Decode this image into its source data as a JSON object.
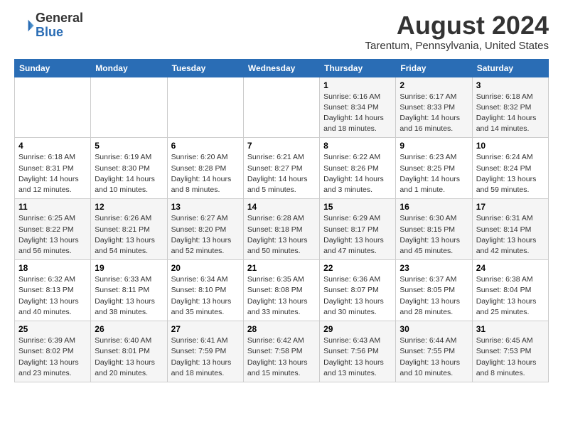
{
  "logo": {
    "general": "General",
    "blue": "Blue"
  },
  "title": "August 2024",
  "location": "Tarentum, Pennsylvania, United States",
  "days_of_week": [
    "Sunday",
    "Monday",
    "Tuesday",
    "Wednesday",
    "Thursday",
    "Friday",
    "Saturday"
  ],
  "weeks": [
    [
      {
        "day": "",
        "info": ""
      },
      {
        "day": "",
        "info": ""
      },
      {
        "day": "",
        "info": ""
      },
      {
        "day": "",
        "info": ""
      },
      {
        "day": "1",
        "info": "Sunrise: 6:16 AM\nSunset: 8:34 PM\nDaylight: 14 hours\nand 18 minutes."
      },
      {
        "day": "2",
        "info": "Sunrise: 6:17 AM\nSunset: 8:33 PM\nDaylight: 14 hours\nand 16 minutes."
      },
      {
        "day": "3",
        "info": "Sunrise: 6:18 AM\nSunset: 8:32 PM\nDaylight: 14 hours\nand 14 minutes."
      }
    ],
    [
      {
        "day": "4",
        "info": "Sunrise: 6:18 AM\nSunset: 8:31 PM\nDaylight: 14 hours\nand 12 minutes."
      },
      {
        "day": "5",
        "info": "Sunrise: 6:19 AM\nSunset: 8:30 PM\nDaylight: 14 hours\nand 10 minutes."
      },
      {
        "day": "6",
        "info": "Sunrise: 6:20 AM\nSunset: 8:28 PM\nDaylight: 14 hours\nand 8 minutes."
      },
      {
        "day": "7",
        "info": "Sunrise: 6:21 AM\nSunset: 8:27 PM\nDaylight: 14 hours\nand 5 minutes."
      },
      {
        "day": "8",
        "info": "Sunrise: 6:22 AM\nSunset: 8:26 PM\nDaylight: 14 hours\nand 3 minutes."
      },
      {
        "day": "9",
        "info": "Sunrise: 6:23 AM\nSunset: 8:25 PM\nDaylight: 14 hours\nand 1 minute."
      },
      {
        "day": "10",
        "info": "Sunrise: 6:24 AM\nSunset: 8:24 PM\nDaylight: 13 hours\nand 59 minutes."
      }
    ],
    [
      {
        "day": "11",
        "info": "Sunrise: 6:25 AM\nSunset: 8:22 PM\nDaylight: 13 hours\nand 56 minutes."
      },
      {
        "day": "12",
        "info": "Sunrise: 6:26 AM\nSunset: 8:21 PM\nDaylight: 13 hours\nand 54 minutes."
      },
      {
        "day": "13",
        "info": "Sunrise: 6:27 AM\nSunset: 8:20 PM\nDaylight: 13 hours\nand 52 minutes."
      },
      {
        "day": "14",
        "info": "Sunrise: 6:28 AM\nSunset: 8:18 PM\nDaylight: 13 hours\nand 50 minutes."
      },
      {
        "day": "15",
        "info": "Sunrise: 6:29 AM\nSunset: 8:17 PM\nDaylight: 13 hours\nand 47 minutes."
      },
      {
        "day": "16",
        "info": "Sunrise: 6:30 AM\nSunset: 8:15 PM\nDaylight: 13 hours\nand 45 minutes."
      },
      {
        "day": "17",
        "info": "Sunrise: 6:31 AM\nSunset: 8:14 PM\nDaylight: 13 hours\nand 42 minutes."
      }
    ],
    [
      {
        "day": "18",
        "info": "Sunrise: 6:32 AM\nSunset: 8:13 PM\nDaylight: 13 hours\nand 40 minutes."
      },
      {
        "day": "19",
        "info": "Sunrise: 6:33 AM\nSunset: 8:11 PM\nDaylight: 13 hours\nand 38 minutes."
      },
      {
        "day": "20",
        "info": "Sunrise: 6:34 AM\nSunset: 8:10 PM\nDaylight: 13 hours\nand 35 minutes."
      },
      {
        "day": "21",
        "info": "Sunrise: 6:35 AM\nSunset: 8:08 PM\nDaylight: 13 hours\nand 33 minutes."
      },
      {
        "day": "22",
        "info": "Sunrise: 6:36 AM\nSunset: 8:07 PM\nDaylight: 13 hours\nand 30 minutes."
      },
      {
        "day": "23",
        "info": "Sunrise: 6:37 AM\nSunset: 8:05 PM\nDaylight: 13 hours\nand 28 minutes."
      },
      {
        "day": "24",
        "info": "Sunrise: 6:38 AM\nSunset: 8:04 PM\nDaylight: 13 hours\nand 25 minutes."
      }
    ],
    [
      {
        "day": "25",
        "info": "Sunrise: 6:39 AM\nSunset: 8:02 PM\nDaylight: 13 hours\nand 23 minutes."
      },
      {
        "day": "26",
        "info": "Sunrise: 6:40 AM\nSunset: 8:01 PM\nDaylight: 13 hours\nand 20 minutes."
      },
      {
        "day": "27",
        "info": "Sunrise: 6:41 AM\nSunset: 7:59 PM\nDaylight: 13 hours\nand 18 minutes."
      },
      {
        "day": "28",
        "info": "Sunrise: 6:42 AM\nSunset: 7:58 PM\nDaylight: 13 hours\nand 15 minutes."
      },
      {
        "day": "29",
        "info": "Sunrise: 6:43 AM\nSunset: 7:56 PM\nDaylight: 13 hours\nand 13 minutes."
      },
      {
        "day": "30",
        "info": "Sunrise: 6:44 AM\nSunset: 7:55 PM\nDaylight: 13 hours\nand 10 minutes."
      },
      {
        "day": "31",
        "info": "Sunrise: 6:45 AM\nSunset: 7:53 PM\nDaylight: 13 hours\nand 8 minutes."
      }
    ]
  ]
}
